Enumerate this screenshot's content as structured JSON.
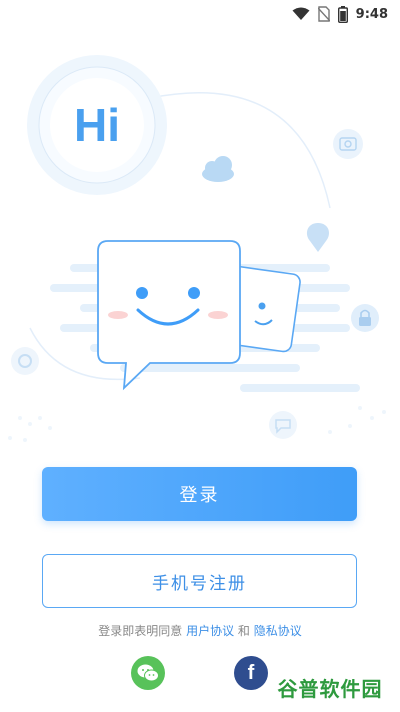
{
  "status_bar": {
    "time": "9:48",
    "icons": [
      "wifi-icon",
      "no-sim-icon",
      "battery-icon"
    ]
  },
  "hero": {
    "logo_text": "Hi",
    "icons": [
      "cloud-icon",
      "camera-icon",
      "location-pin-icon",
      "lock-icon",
      "settings-icon",
      "message-icon"
    ]
  },
  "actions": {
    "login_label": "登录",
    "register_label": "手机号注册"
  },
  "agreement": {
    "prefix": "登录即表明同意",
    "user_agreement": "用户协议",
    "conjunction": "和",
    "privacy_agreement": "隐私协议"
  },
  "social": {
    "icons": [
      "wechat-icon",
      "facebook-icon"
    ],
    "facebook_glyph": "f"
  },
  "watermark": {
    "text": "谷普软件园"
  },
  "colors": {
    "primary": "#3f9df8",
    "primary_light": "#5fb0ff",
    "wechat_green": "#58c25a",
    "facebook_blue": "#2f4d8f"
  }
}
